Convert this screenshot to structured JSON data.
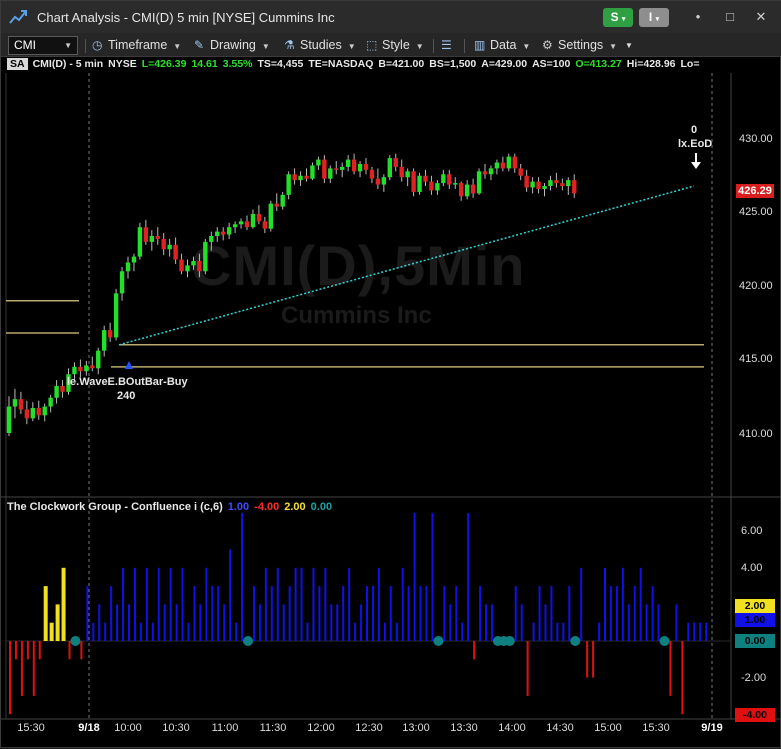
{
  "window": {
    "title": "Chart Analysis - CMI(D) 5 min [NYSE] Cummins Inc",
    "btn_s": "S",
    "btn_i": "I",
    "minimize_glyph": "•",
    "maximize_glyph": "□",
    "close_glyph": "✕"
  },
  "toolbar": {
    "symbol": "CMI",
    "timeframe": "Timeframe",
    "drawing": "Drawing",
    "studies": "Studies",
    "style": "Style",
    "data": "Data",
    "settings": "Settings"
  },
  "infobar": {
    "badge": "SA",
    "symbol": "CMI(D) - 5 min",
    "exchange": "NYSE",
    "last": "L=426.39",
    "change": "14.61",
    "pct": "3.55%",
    "ts": "TS=4,455",
    "te": "TE=NASDAQ",
    "bid": "B=421.00",
    "bs": "BS=1,500",
    "ask": "A=429.00",
    "as": "AS=100",
    "open": "O=413.27",
    "high": "Hi=428.96",
    "low": "Lo="
  },
  "watermark": {
    "main": "CMI(D),5Min",
    "sub": "Cummins Inc"
  },
  "annotations": {
    "buy_label": "le.WaveE.BOutBar-Buy",
    "buy_qty": "240",
    "exit_qty": "0",
    "exit_label": "lx.EoD"
  },
  "price_axis": {
    "ticks": [
      "430.00",
      "425.00",
      "420.00",
      "415.00",
      "410.00"
    ],
    "current": "426.29"
  },
  "indicator": {
    "name": "The Clockwork Group - Confluence i (c,6)",
    "v1": "1.00",
    "v2": "-4.00",
    "v3": "2.00",
    "v4": "0.00",
    "axis_ticks": [
      "6.00",
      "4.00",
      "-2.00"
    ],
    "badges": {
      "yellow": "2.00",
      "blue": "1.00",
      "teal": "0.00",
      "red": "-4.00"
    }
  },
  "time_axis": [
    "15:30",
    "9/18",
    "10:00",
    "10:30",
    "11:00",
    "11:30",
    "12:00",
    "12:30",
    "13:00",
    "13:30",
    "14:00",
    "14:30",
    "15:00",
    "15:30",
    "9/19"
  ],
  "colors": {
    "up": "#22e02a",
    "down": "#e02222",
    "trend": "#2fd6d6",
    "level": "#b8a86a",
    "ind_blue": "#1010e8",
    "ind_red": "#e01010",
    "ind_yellow": "#f0e020",
    "ind_teal": "#0e8080"
  },
  "chart_data": {
    "type": "candlestick",
    "interval": "5 min",
    "y_range": [
      408.5,
      431.5
    ],
    "candles": [
      {
        "o": 410.0,
        "h": 412.5,
        "l": 409.8,
        "c": 411.8
      },
      {
        "o": 411.8,
        "h": 413.0,
        "l": 411.0,
        "c": 412.3
      },
      {
        "o": 412.3,
        "h": 412.8,
        "l": 411.3,
        "c": 411.6
      },
      {
        "o": 411.6,
        "h": 412.2,
        "l": 410.6,
        "c": 411.0
      },
      {
        "o": 411.0,
        "h": 412.1,
        "l": 410.8,
        "c": 411.7
      },
      {
        "o": 411.7,
        "h": 412.2,
        "l": 410.9,
        "c": 411.2
      },
      {
        "o": 411.2,
        "h": 412.0,
        "l": 410.8,
        "c": 411.8
      },
      {
        "o": 411.8,
        "h": 412.6,
        "l": 411.4,
        "c": 412.4
      },
      {
        "o": 412.4,
        "h": 413.6,
        "l": 412.0,
        "c": 413.2
      },
      {
        "o": 413.2,
        "h": 413.6,
        "l": 412.4,
        "c": 412.8
      },
      {
        "o": 412.8,
        "h": 414.4,
        "l": 412.6,
        "c": 414.0
      },
      {
        "o": 414.0,
        "h": 414.8,
        "l": 413.6,
        "c": 414.5
      },
      {
        "o": 414.5,
        "h": 415.0,
        "l": 413.8,
        "c": 414.2
      },
      {
        "o": 414.2,
        "h": 414.9,
        "l": 413.9,
        "c": 414.6
      },
      {
        "o": 414.6,
        "h": 415.2,
        "l": 414.2,
        "c": 414.4
      },
      {
        "o": 414.4,
        "h": 415.8,
        "l": 414.0,
        "c": 415.6
      },
      {
        "o": 415.6,
        "h": 417.3,
        "l": 415.2,
        "c": 417.0
      },
      {
        "o": 417.0,
        "h": 417.5,
        "l": 416.2,
        "c": 416.5
      },
      {
        "o": 416.5,
        "h": 419.8,
        "l": 416.3,
        "c": 419.5
      },
      {
        "o": 419.5,
        "h": 421.3,
        "l": 419.0,
        "c": 421.0
      },
      {
        "o": 421.0,
        "h": 422.0,
        "l": 420.5,
        "c": 421.6
      },
      {
        "o": 421.6,
        "h": 422.2,
        "l": 421.0,
        "c": 422.0
      },
      {
        "o": 422.0,
        "h": 424.3,
        "l": 421.8,
        "c": 424.0
      },
      {
        "o": 424.0,
        "h": 424.5,
        "l": 422.8,
        "c": 423.0
      },
      {
        "o": 423.0,
        "h": 423.8,
        "l": 422.4,
        "c": 423.4
      },
      {
        "o": 423.4,
        "h": 424.0,
        "l": 422.8,
        "c": 423.2
      },
      {
        "o": 423.2,
        "h": 423.6,
        "l": 422.1,
        "c": 422.5
      },
      {
        "o": 422.5,
        "h": 423.2,
        "l": 422.0,
        "c": 422.8
      },
      {
        "o": 422.8,
        "h": 423.3,
        "l": 421.5,
        "c": 421.8
      },
      {
        "o": 421.8,
        "h": 422.2,
        "l": 420.8,
        "c": 421.0
      },
      {
        "o": 421.0,
        "h": 421.8,
        "l": 420.6,
        "c": 421.4
      },
      {
        "o": 421.4,
        "h": 422.0,
        "l": 421.1,
        "c": 421.7
      },
      {
        "o": 421.7,
        "h": 422.2,
        "l": 420.6,
        "c": 421.0
      },
      {
        "o": 421.0,
        "h": 423.2,
        "l": 420.8,
        "c": 423.0
      },
      {
        "o": 423.0,
        "h": 423.7,
        "l": 422.4,
        "c": 423.4
      },
      {
        "o": 423.4,
        "h": 424.0,
        "l": 423.0,
        "c": 423.7
      },
      {
        "o": 423.7,
        "h": 424.0,
        "l": 423.1,
        "c": 423.5
      },
      {
        "o": 423.5,
        "h": 424.3,
        "l": 423.2,
        "c": 424.0
      },
      {
        "o": 424.0,
        "h": 424.4,
        "l": 423.6,
        "c": 424.2
      },
      {
        "o": 424.2,
        "h": 424.6,
        "l": 423.9,
        "c": 424.4
      },
      {
        "o": 424.4,
        "h": 424.8,
        "l": 423.8,
        "c": 424.0
      },
      {
        "o": 424.0,
        "h": 425.2,
        "l": 423.9,
        "c": 424.9
      },
      {
        "o": 424.9,
        "h": 425.5,
        "l": 424.2,
        "c": 424.4
      },
      {
        "o": 424.4,
        "h": 424.7,
        "l": 423.6,
        "c": 423.9
      },
      {
        "o": 423.9,
        "h": 425.8,
        "l": 423.7,
        "c": 425.6
      },
      {
        "o": 425.6,
        "h": 426.3,
        "l": 425.1,
        "c": 425.4
      },
      {
        "o": 425.4,
        "h": 426.4,
        "l": 425.2,
        "c": 426.2
      },
      {
        "o": 426.2,
        "h": 427.8,
        "l": 425.9,
        "c": 427.6
      },
      {
        "o": 427.6,
        "h": 428.0,
        "l": 426.9,
        "c": 427.2
      },
      {
        "o": 427.2,
        "h": 427.8,
        "l": 426.8,
        "c": 427.5
      },
      {
        "o": 427.5,
        "h": 428.0,
        "l": 427.1,
        "c": 427.3
      },
      {
        "o": 427.3,
        "h": 428.4,
        "l": 427.2,
        "c": 428.2
      },
      {
        "o": 428.2,
        "h": 428.8,
        "l": 427.9,
        "c": 428.6
      },
      {
        "o": 428.6,
        "h": 428.9,
        "l": 427.0,
        "c": 427.3
      },
      {
        "o": 427.3,
        "h": 428.2,
        "l": 427.0,
        "c": 428.0
      },
      {
        "o": 428.0,
        "h": 428.5,
        "l": 427.6,
        "c": 427.9
      },
      {
        "o": 427.9,
        "h": 428.4,
        "l": 427.4,
        "c": 428.1
      },
      {
        "o": 428.1,
        "h": 428.9,
        "l": 427.8,
        "c": 428.6
      },
      {
        "o": 428.6,
        "h": 429.0,
        "l": 427.6,
        "c": 427.8
      },
      {
        "o": 427.8,
        "h": 428.5,
        "l": 427.4,
        "c": 428.3
      },
      {
        "o": 428.3,
        "h": 428.7,
        "l": 427.6,
        "c": 427.9
      },
      {
        "o": 427.9,
        "h": 428.1,
        "l": 427.0,
        "c": 427.3
      },
      {
        "o": 427.3,
        "h": 428.0,
        "l": 426.6,
        "c": 426.9
      },
      {
        "o": 426.9,
        "h": 427.6,
        "l": 426.4,
        "c": 427.4
      },
      {
        "o": 427.4,
        "h": 428.9,
        "l": 427.2,
        "c": 428.7
      },
      {
        "o": 428.7,
        "h": 429.0,
        "l": 427.8,
        "c": 428.1
      },
      {
        "o": 428.1,
        "h": 428.6,
        "l": 427.1,
        "c": 427.4
      },
      {
        "o": 427.4,
        "h": 428.0,
        "l": 426.8,
        "c": 427.8
      },
      {
        "o": 427.8,
        "h": 428.0,
        "l": 426.1,
        "c": 426.4
      },
      {
        "o": 426.4,
        "h": 427.7,
        "l": 426.2,
        "c": 427.5
      },
      {
        "o": 427.5,
        "h": 427.9,
        "l": 426.8,
        "c": 427.1
      },
      {
        "o": 427.1,
        "h": 427.5,
        "l": 426.2,
        "c": 426.5
      },
      {
        "o": 426.5,
        "h": 427.2,
        "l": 426.2,
        "c": 427.0
      },
      {
        "o": 427.0,
        "h": 427.9,
        "l": 426.8,
        "c": 427.6
      },
      {
        "o": 427.6,
        "h": 427.9,
        "l": 426.6,
        "c": 426.9
      },
      {
        "o": 426.9,
        "h": 427.4,
        "l": 426.6,
        "c": 427.0
      },
      {
        "o": 427.0,
        "h": 427.1,
        "l": 425.8,
        "c": 426.1
      },
      {
        "o": 426.1,
        "h": 427.2,
        "l": 425.9,
        "c": 426.9
      },
      {
        "o": 426.9,
        "h": 427.3,
        "l": 426.0,
        "c": 426.3
      },
      {
        "o": 426.3,
        "h": 428.0,
        "l": 426.2,
        "c": 427.8
      },
      {
        "o": 427.8,
        "h": 428.3,
        "l": 427.3,
        "c": 427.6
      },
      {
        "o": 427.6,
        "h": 428.2,
        "l": 427.2,
        "c": 428.0
      },
      {
        "o": 428.0,
        "h": 428.6,
        "l": 427.6,
        "c": 428.4
      },
      {
        "o": 428.4,
        "h": 428.8,
        "l": 427.8,
        "c": 428.0
      },
      {
        "o": 428.0,
        "h": 429.0,
        "l": 427.8,
        "c": 428.8
      },
      {
        "o": 428.8,
        "h": 429.0,
        "l": 427.7,
        "c": 428.0
      },
      {
        "o": 428.0,
        "h": 428.3,
        "l": 427.2,
        "c": 427.5
      },
      {
        "o": 427.5,
        "h": 427.9,
        "l": 426.4,
        "c": 426.7
      },
      {
        "o": 426.7,
        "h": 427.4,
        "l": 426.3,
        "c": 427.1
      },
      {
        "o": 427.1,
        "h": 427.4,
        "l": 426.3,
        "c": 426.6
      },
      {
        "o": 426.6,
        "h": 427.0,
        "l": 426.1,
        "c": 426.8
      },
      {
        "o": 426.8,
        "h": 427.5,
        "l": 426.5,
        "c": 427.2
      },
      {
        "o": 427.2,
        "h": 427.7,
        "l": 426.7,
        "c": 427.0
      },
      {
        "o": 427.0,
        "h": 427.3,
        "l": 426.5,
        "c": 426.8
      },
      {
        "o": 426.8,
        "h": 427.4,
        "l": 426.2,
        "c": 427.2
      },
      {
        "o": 427.2,
        "h": 427.6,
        "l": 426.0,
        "c": 426.3
      }
    ],
    "horizontal_levels": [
      419.0,
      416.8,
      416.0,
      414.5
    ],
    "trend_line": {
      "from_price": 416.0,
      "to_price": 426.8
    },
    "indicator_values": [
      -4,
      -1,
      -3,
      -1,
      -3,
      -1,
      3,
      1,
      2,
      4,
      -1,
      0,
      -1,
      3,
      1,
      2,
      1,
      3,
      2,
      4,
      2,
      4,
      1,
      4,
      1,
      4,
      2,
      4,
      2,
      4,
      1,
      3,
      2,
      4,
      3,
      3,
      2,
      5,
      1,
      7,
      0,
      3,
      2,
      4,
      3,
      4,
      2,
      3,
      4,
      4,
      1,
      4,
      3,
      4,
      2,
      2,
      3,
      4,
      1,
      2,
      3,
      3,
      4,
      1,
      3,
      1,
      4,
      3,
      7,
      3,
      3,
      7,
      0,
      3,
      2,
      3,
      1,
      7,
      -1,
      3,
      2,
      2,
      0,
      0,
      0,
      3,
      2,
      -3,
      1,
      3,
      2,
      3,
      1,
      1,
      3,
      0,
      4,
      -2,
      -2,
      1,
      4,
      3,
      3,
      4,
      2,
      3,
      4,
      2,
      3,
      2,
      0,
      -3,
      2,
      -4,
      1,
      1,
      1,
      1
    ]
  }
}
